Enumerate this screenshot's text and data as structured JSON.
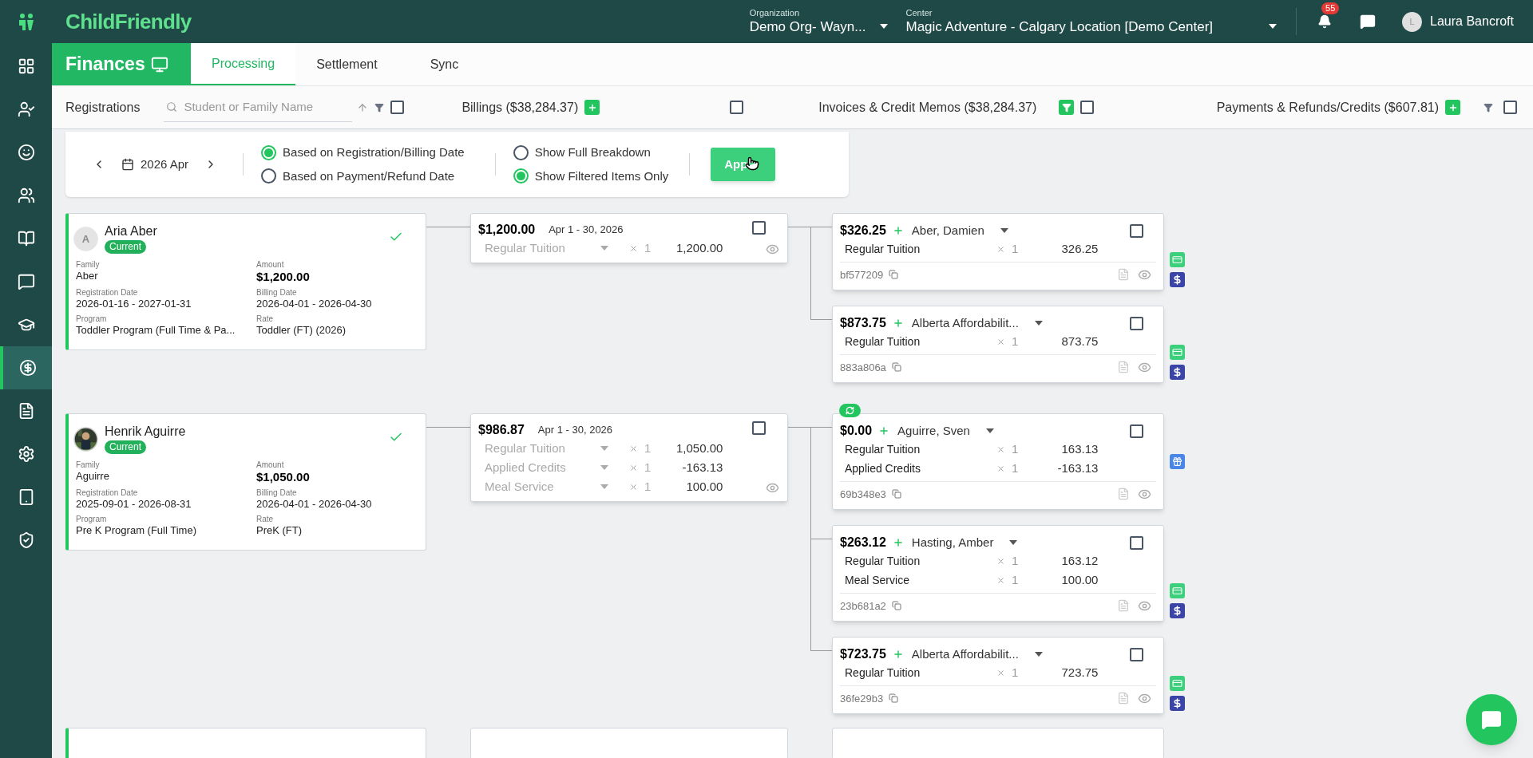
{
  "app": {
    "logo": "ChildFriendly"
  },
  "header": {
    "organization": {
      "label": "Organization",
      "value": "Demo Org- Wayn..."
    },
    "center": {
      "label": "Center",
      "value": "Magic Adventure - Calgary Location [Demo Center]"
    },
    "notifications": "55",
    "user": {
      "initial": "L",
      "name": "Laura Bancroft"
    }
  },
  "sidebar": {
    "items": [
      {
        "selected": false
      },
      {
        "selected": false
      },
      {
        "selected": false
      },
      {
        "selected": false
      },
      {
        "selected": false
      },
      {
        "selected": false
      },
      {
        "selected": false
      },
      {
        "selected": true
      },
      {
        "selected": false
      },
      {
        "selected": false
      },
      {
        "selected": false
      },
      {
        "selected": false
      }
    ]
  },
  "module": {
    "title": "Finances"
  },
  "tabs": [
    {
      "label": "Processing",
      "selected": true
    },
    {
      "label": "Settlement",
      "selected": false
    },
    {
      "label": "Sync",
      "selected": false
    }
  ],
  "columns": {
    "registrations": {
      "title": "Registrations",
      "search_placeholder": "Student or Family Name",
      "filter_active": false,
      "checked": false
    },
    "billings": {
      "title": "Billings ($38,284.37)",
      "checked": false
    },
    "invoices": {
      "title": "Invoices & Credit Memos ($38,284.37)",
      "filter_active": true,
      "checked": false
    },
    "payments": {
      "title": "Payments & Refunds/Credits ($607.81)",
      "filter_active": false,
      "checked": false
    }
  },
  "filters": {
    "period": "2026 Apr",
    "date_basis": [
      {
        "label": "Based on Registration/Billing Date",
        "selected": true
      },
      {
        "label": "Based on Payment/Refund Date",
        "selected": false
      }
    ],
    "breakdown": [
      {
        "label": "Show Full Breakdown",
        "selected": false
      },
      {
        "label": "Show Filtered Items Only",
        "selected": true
      }
    ],
    "apply": "App"
  },
  "groups": [
    {
      "registration": {
        "name": "Aria Aber",
        "avatar": {
          "kind": "initial",
          "initial": "A"
        },
        "status": "Current",
        "verified": true,
        "fields": [
          {
            "label": "Family",
            "value": "Aber",
            "kind": "text"
          },
          {
            "label": "Amount",
            "value": "$1,200.00",
            "kind": "amount"
          },
          {
            "label": "Registration Date",
            "value": "2026-01-16 - 2027-01-31",
            "kind": "text"
          },
          {
            "label": "Billing Date",
            "value": "2026-04-01 - 2026-04-30",
            "kind": "text"
          },
          {
            "label": "Program",
            "value": "Toddler Program (Full Time & Pa...",
            "kind": "text"
          },
          {
            "label": "Rate",
            "value": "Toddler (FT) (2026)",
            "kind": "text"
          }
        ]
      },
      "billing": {
        "amount": "$1,200.00",
        "period": "Apr 1 - 30, 2026",
        "checked": false,
        "lines": [
          {
            "item": "Regular Tuition",
            "qty": "1",
            "amount": "1,200.00"
          }
        ]
      },
      "invoices": [
        {
          "amount": "$326.25",
          "payer": "Aber, Damien",
          "checked": false,
          "kind": "paid",
          "synced": false,
          "ref": "bf577209",
          "lines": [
            {
              "item": "Regular Tuition",
              "qty": "1",
              "amount": "326.25"
            }
          ]
        },
        {
          "amount": "$873.75",
          "payer": "Alberta Affordabilit...",
          "checked": false,
          "kind": "paid",
          "synced": false,
          "ref": "883a806a",
          "lines": [
            {
              "item": "Regular Tuition",
              "qty": "1",
              "amount": "873.75"
            }
          ]
        }
      ]
    },
    {
      "registration": {
        "name": "Henrik Aguirre",
        "status": "Current",
        "verified": true,
        "fields": [
          {
            "label": "Family",
            "value": "Aguirre",
            "kind": "text"
          },
          {
            "label": "Amount",
            "value": "$1,050.00",
            "kind": "amount"
          },
          {
            "label": "Registration Date",
            "value": "2025-09-01 - 2026-08-31",
            "kind": "text"
          },
          {
            "label": "Billing Date",
            "value": "2026-04-01 - 2026-04-30",
            "kind": "text"
          },
          {
            "label": "Program",
            "value": "Pre K Program (Full Time)",
            "kind": "text"
          },
          {
            "label": "Rate",
            "value": "PreK (FT)",
            "kind": "text"
          }
        ]
      },
      "billing": {
        "amount": "$986.87",
        "period": "Apr 1 - 30, 2026",
        "checked": false,
        "lines": [
          {
            "item": "Regular Tuition",
            "qty": "1",
            "amount": "1,050.00"
          },
          {
            "item": "Applied Credits",
            "qty": "1",
            "amount": "-163.13"
          },
          {
            "item": "Meal Service",
            "qty": "1",
            "amount": "100.00"
          }
        ]
      },
      "invoices": [
        {
          "amount": "$0.00",
          "payer": "Aguirre, Sven",
          "checked": false,
          "kind": "credit",
          "synced": true,
          "ref": "69b348e3",
          "lines": [
            {
              "item": "Regular Tuition",
              "qty": "1",
              "amount": "163.13"
            },
            {
              "item": "Applied Credits",
              "qty": "1",
              "amount": "-163.13"
            }
          ]
        },
        {
          "amount": "$263.12",
          "payer": "Hasting, Amber",
          "checked": false,
          "kind": "paid",
          "synced": false,
          "ref": "23b681a2",
          "lines": [
            {
              "item": "Regular Tuition",
              "qty": "1",
              "amount": "163.12"
            },
            {
              "item": "Meal Service",
              "qty": "1",
              "amount": "100.00"
            }
          ]
        },
        {
          "amount": "$723.75",
          "payer": "Alberta Affordabilit...",
          "checked": false,
          "kind": "paid",
          "synced": false,
          "ref": "36fe29b3",
          "lines": [
            {
              "item": "Regular Tuition",
              "qty": "1",
              "amount": "723.75"
            }
          ]
        }
      ]
    }
  ]
}
